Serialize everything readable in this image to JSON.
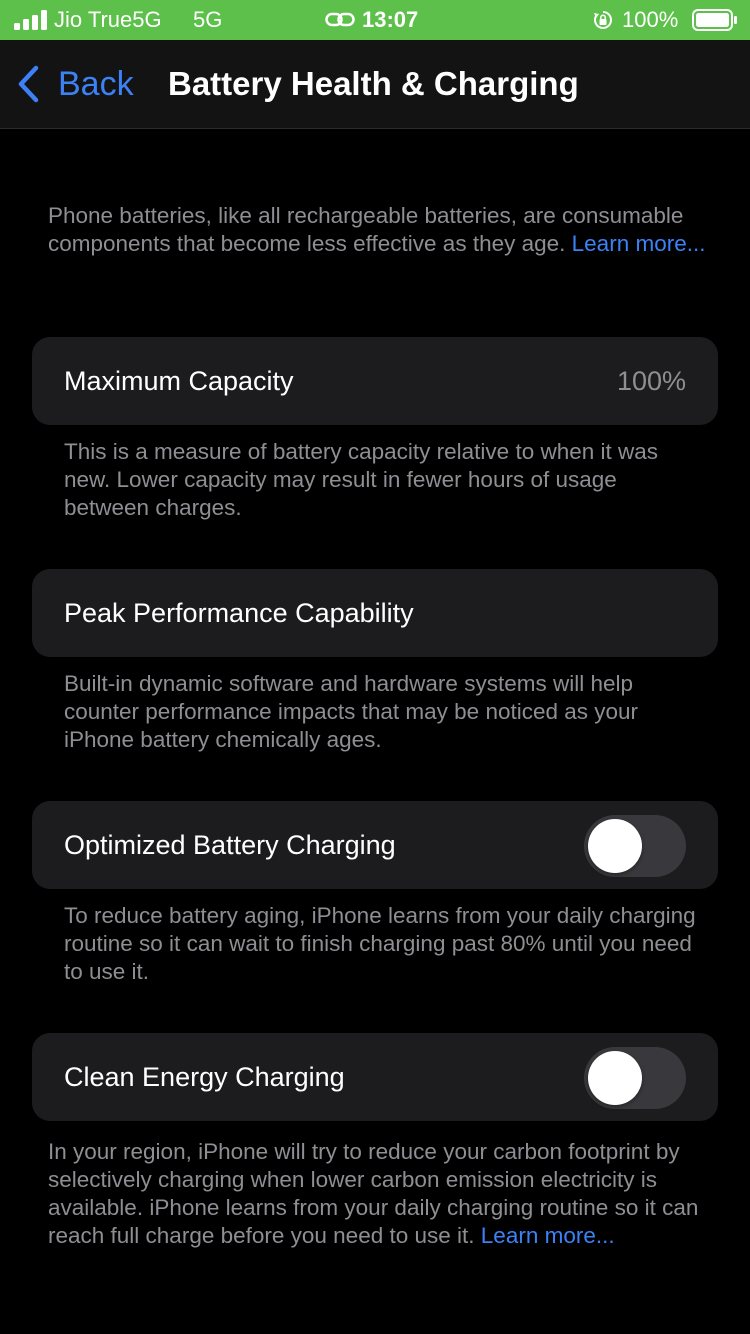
{
  "status_bar": {
    "carrier": "Jio True5G",
    "network": "5G",
    "time": "13:07",
    "battery_percent": "100%",
    "background_color": "#5cc04a"
  },
  "nav": {
    "back_label": "Back",
    "title": "Battery Health & Charging",
    "accent_color": "#3c82f6"
  },
  "intro": {
    "text": "Phone batteries, like all rechargeable batteries, are consumable components that become less effective as they age.",
    "link": "Learn more..."
  },
  "maximum_capacity": {
    "label": "Maximum Capacity",
    "value": "100%",
    "footer": "This is a measure of battery capacity relative to when it was new. Lower capacity may result in fewer hours of usage between charges."
  },
  "peak_performance": {
    "label": "Peak Performance Capability",
    "footer": "Built-in dynamic software and hardware systems will help counter performance impacts that may be noticed as your iPhone battery chemically ages."
  },
  "optimized_charging": {
    "label": "Optimized Battery Charging",
    "enabled": false,
    "footer": "To reduce battery aging, iPhone learns from your daily charging routine so it can wait to finish charging past 80% until you need to use it."
  },
  "clean_energy": {
    "label": "Clean Energy Charging",
    "enabled": false,
    "footer": "In your region, iPhone will try to reduce your carbon footprint by selectively charging when lower carbon emission electricity is available. iPhone learns from your daily charging routine so it can reach full charge before you need to use it.",
    "link": "Learn more..."
  }
}
